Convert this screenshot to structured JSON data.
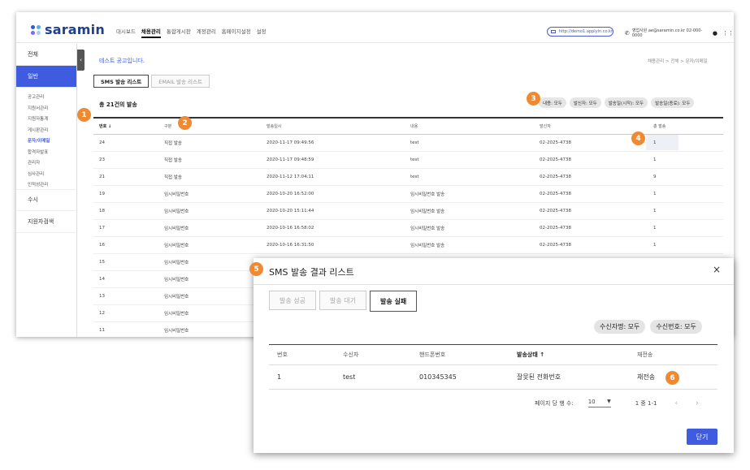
{
  "header": {
    "logo_text": "saramin",
    "nav": [
      "대시보드",
      "채용관리",
      "통합게시판",
      "계정관리",
      "홈페이지설정",
      "설정"
    ],
    "active_nav": "채용관리",
    "demo_link": "http://demo1.applyin.co.kr",
    "contact": "영업사원 ae@saramin.co.kr 02-000-0000"
  },
  "sidebar": {
    "toggle_glyph": "‹",
    "top_item": "전체",
    "active_section": "일반",
    "sub_items": [
      "공고관리",
      "지원서관리",
      "지원자통계",
      "게시판관리",
      "문자/이메일",
      "합격자발표",
      "관리자",
      "심사관리",
      "인적성관리"
    ],
    "active_sub": "문자/이메일",
    "section_2": "수시",
    "section_3": "지원자검색"
  },
  "main": {
    "notice": "테스트 공고입니다.",
    "breadcrumb": "채용관리 > 전체 > 문자/이메일",
    "tabs": [
      "SMS 발송 리스트",
      "EMAIL 발송 리스트"
    ],
    "count_text": "총 21건의 발송",
    "filters": [
      "내용: 모두",
      "발신자: 모두",
      "발송일(시작): 모두",
      "발송일(종료): 모두"
    ],
    "columns": [
      "번호",
      "구분",
      "발송일시",
      "내용",
      "발신자",
      "총 발송"
    ],
    "sort_glyph": "↓",
    "rows": [
      [
        "24",
        "직접 발송",
        "2020-11-17 09:49:56",
        "test",
        "02-2025-4738",
        "1"
      ],
      [
        "23",
        "직접 발송",
        "2020-11-17 09:48:59",
        "test",
        "02-2025-4738",
        "1"
      ],
      [
        "21",
        "직접 발송",
        "2020-11-12 17:04:11",
        "test",
        "02-2025-4738",
        "9"
      ],
      [
        "19",
        "임시비밀번호",
        "2020-10-20 16:52:00",
        "임시비밀번호 발송",
        "02-2025-4738",
        "1"
      ],
      [
        "18",
        "임시비밀번호",
        "2020-10-20 15:11:44",
        "임시비밀번호 발송",
        "02-2025-4738",
        "1"
      ],
      [
        "17",
        "임시비밀번호",
        "2020-10-16 16:58:02",
        "임시비밀번호 발송",
        "02-2025-4738",
        "1"
      ],
      [
        "16",
        "임시비밀번호",
        "2020-10-16 16:31:50",
        "임시비밀번호 발송",
        "02-2025-4738",
        "1"
      ],
      [
        "15",
        "임시비밀번호",
        "",
        "",
        "",
        ""
      ],
      [
        "14",
        "임시비밀번호",
        "",
        "",
        "",
        ""
      ],
      [
        "13",
        "임시비밀번호",
        "",
        "",
        "",
        ""
      ],
      [
        "12",
        "임시비밀번호",
        "",
        "",
        "",
        ""
      ],
      [
        "11",
        "임시비밀번호",
        "",
        "",
        "",
        ""
      ]
    ]
  },
  "modal": {
    "title": "SMS 발송 결과 리스트",
    "close_glyph": "×",
    "tabs": [
      "발송 성공",
      "발송 대기",
      "발송 실패"
    ],
    "active_tab": "발송 실패",
    "filters": [
      "수신자명: 모두",
      "수신번호: 모두"
    ],
    "columns": [
      "번호",
      "수신자",
      "핸드폰번호",
      "발송상태",
      "재전송"
    ],
    "sort_glyph": "↑",
    "rows": [
      [
        "1",
        "test",
        "010345345",
        "잘못된 전화번호",
        "재전송"
      ]
    ],
    "page_size_label": "페이지 당 행 수:",
    "page_size": "10",
    "range": "1 중 1-1",
    "prev": "‹",
    "next": "›",
    "close_label": "닫기"
  },
  "badges": [
    "1",
    "2",
    "3",
    "4",
    "5",
    "6"
  ],
  "colors": {
    "accent": "#3f5ce0",
    "badge": "#f08a32",
    "logo_dots": [
      "#2a5dd6",
      "#4fb0e8",
      "#7b6cf0",
      "#9fd0ff"
    ]
  }
}
